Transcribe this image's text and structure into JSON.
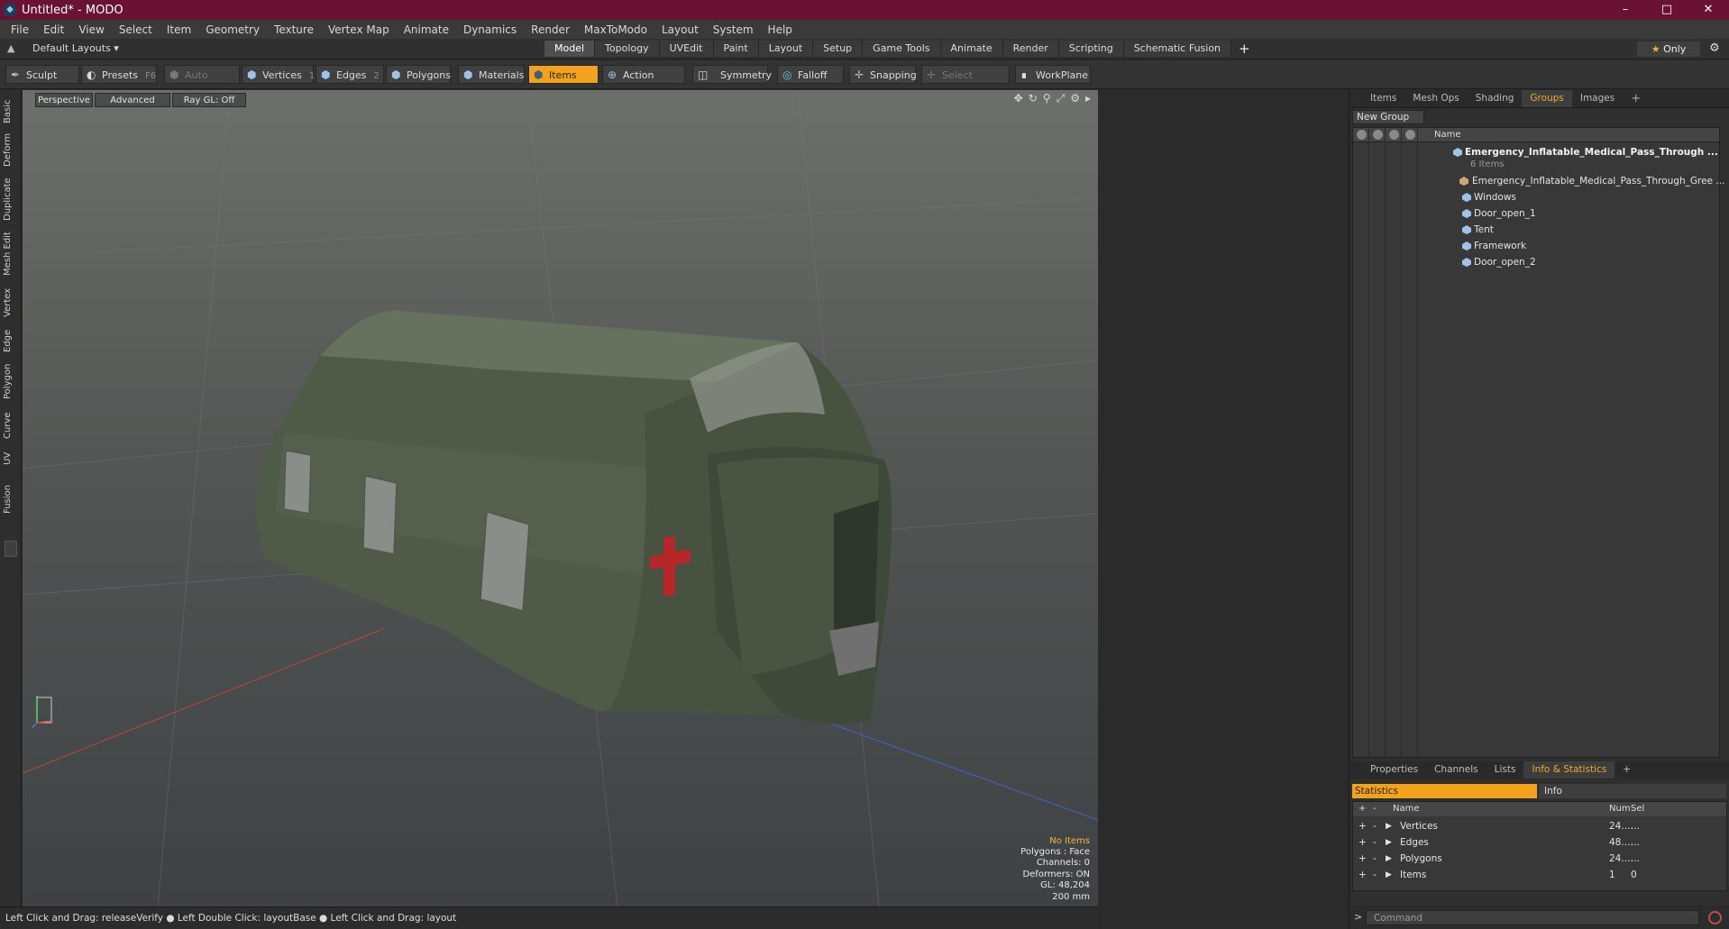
{
  "window": {
    "title": "Untitled* - MODO",
    "app_icon": "modo-icon",
    "controls": [
      "–",
      "□",
      "✕"
    ]
  },
  "menu": [
    "File",
    "Edit",
    "View",
    "Select",
    "Item",
    "Geometry",
    "Texture",
    "Vertex Map",
    "Animate",
    "Dynamics",
    "Render",
    "MaxToModo",
    "Layout",
    "System",
    "Help"
  ],
  "layoutbar": {
    "layout_select": "Default Layouts ▾",
    "tabs": [
      "Model",
      "Topology",
      "UVEdit",
      "Paint",
      "Layout",
      "Setup",
      "Game Tools",
      "Animate",
      "Render",
      "Scripting",
      "Schematic Fusion"
    ],
    "active_tab": "Model",
    "add": "+",
    "only": "Only"
  },
  "toolbar": {
    "sculpt": "Sculpt",
    "presets": "Presets",
    "presets_shortcut": "F6",
    "auto_select": "Auto Select",
    "vertices": "Vertices",
    "vertices_shortcut": "1",
    "edges": "Edges",
    "edges_shortcut": "2",
    "polygons": "Polygons",
    "materials": "Materials",
    "items": "Items",
    "action_center": "Action Center",
    "symmetry": "Symmetry",
    "falloff": "Falloff",
    "snapping": "Snapping",
    "select_through": "Select Through",
    "workplane": "WorkPlane"
  },
  "left_tabs": [
    "Basic",
    "Deform",
    "Duplicate",
    "Mesh Edit",
    "Vertex",
    "Edge",
    "Polygon",
    "Curve",
    "UV",
    "Fusion"
  ],
  "viewport": {
    "view": "Perspective",
    "shading": "Advanced",
    "raygl": "Ray GL: Off",
    "info": {
      "selection": "No Items",
      "polygons": "Polygons : Face",
      "channels": "Channels: 0",
      "deformers": "Deformers: ON",
      "gl": "GL: 48,204",
      "scale": "200 mm"
    }
  },
  "status": "Left Click and Drag: releaseVerify ● Left Double Click: layoutBase ● Left Click and Drag: layout",
  "groups_panel": {
    "tabs": [
      "Items",
      "Mesh Ops",
      "Shading",
      "Groups",
      "Images"
    ],
    "active_tab": "Groups",
    "add": "+",
    "new_group": "New Group",
    "column_name": "Name",
    "group": {
      "name": "Emergency_Inflatable_Medical_Pass_Through ...",
      "count": "6 Items"
    },
    "children": [
      "Emergency_Inflatable_Medical_Pass_Through_Gree ...",
      "Windows",
      "Door_open_1",
      "Tent",
      "Framework",
      "Door_open_2"
    ]
  },
  "info_panel": {
    "tabs": [
      "Properties",
      "Channels",
      "Lists",
      "Info & Statistics"
    ],
    "active_tab": "Info & Statistics",
    "add": "+",
    "sub_tabs": [
      "Statistics",
      "Info"
    ],
    "headers": {
      "name": "Name",
      "num": "Num",
      "sel": "Sel"
    },
    "rows": [
      {
        "name": "Vertices",
        "num": "24....",
        "sel": "..."
      },
      {
        "name": "Edges",
        "num": "48....",
        "sel": "..."
      },
      {
        "name": "Polygons",
        "num": "24....",
        "sel": "..."
      },
      {
        "name": "Items",
        "num": "1",
        "sel": "0"
      }
    ]
  },
  "command": {
    "placeholder": "Command"
  }
}
